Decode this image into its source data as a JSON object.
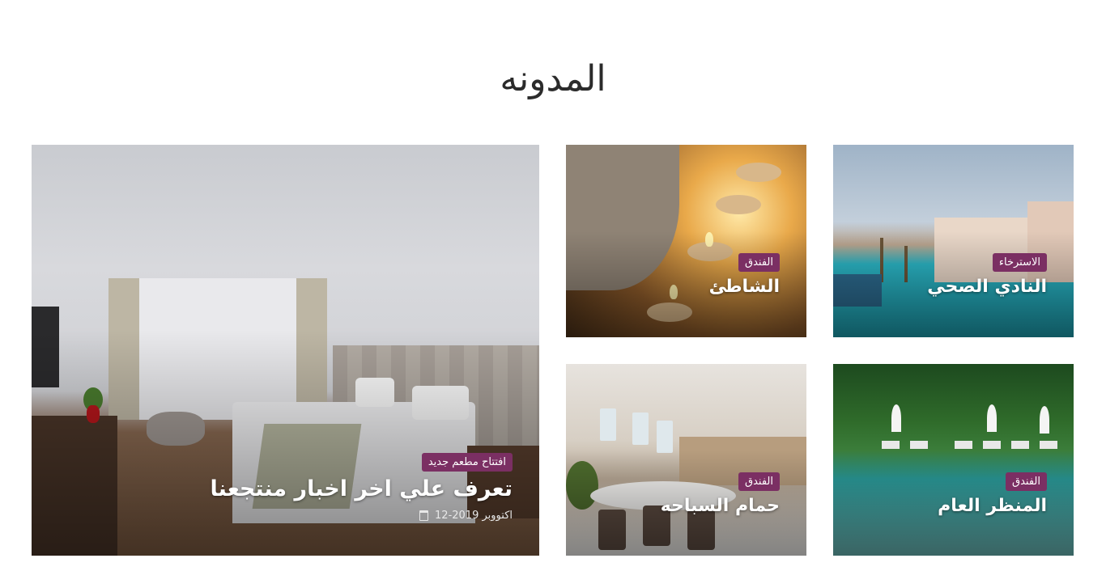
{
  "section": {
    "title": "المدونه"
  },
  "featured": {
    "category": "افتتاح مطعم جديد",
    "title": "تعرف علي اخر اخبار منتجعنا",
    "date": "اكتووبر 2019-12",
    "date_icon": "calendar-icon"
  },
  "cards": [
    {
      "category": "الاسترخاء",
      "title": "النادي الصحي"
    },
    {
      "category": "الفندق",
      "title": "الشاطئ"
    },
    {
      "category": "الفندق",
      "title": "المنظر العام"
    },
    {
      "category": "الفندق",
      "title": "حمام السباحه"
    }
  ],
  "colors": {
    "badge": "#7b2f63",
    "title": "#2b2b2b"
  }
}
